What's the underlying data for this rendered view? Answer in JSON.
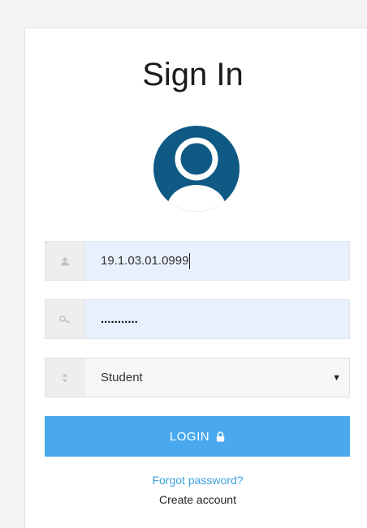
{
  "form": {
    "title": "Sign In",
    "username_value": "19.1.03.01.0999",
    "password_mask": "...........",
    "role_selected": "Student",
    "login_label": "LOGIN",
    "forgot_label": "Forgot password?",
    "create_label": "Create account"
  },
  "icons": {
    "avatar": "user-avatar-icon",
    "username": "user-icon",
    "password": "key-icon",
    "role": "sort-icon",
    "login": "lock-icon",
    "dropdown": "triangle-down-icon"
  },
  "colors": {
    "avatar": "#0f5a85",
    "button": "#4aa8ee",
    "link": "#3ba3df",
    "autofill": "#e8f0fe"
  }
}
